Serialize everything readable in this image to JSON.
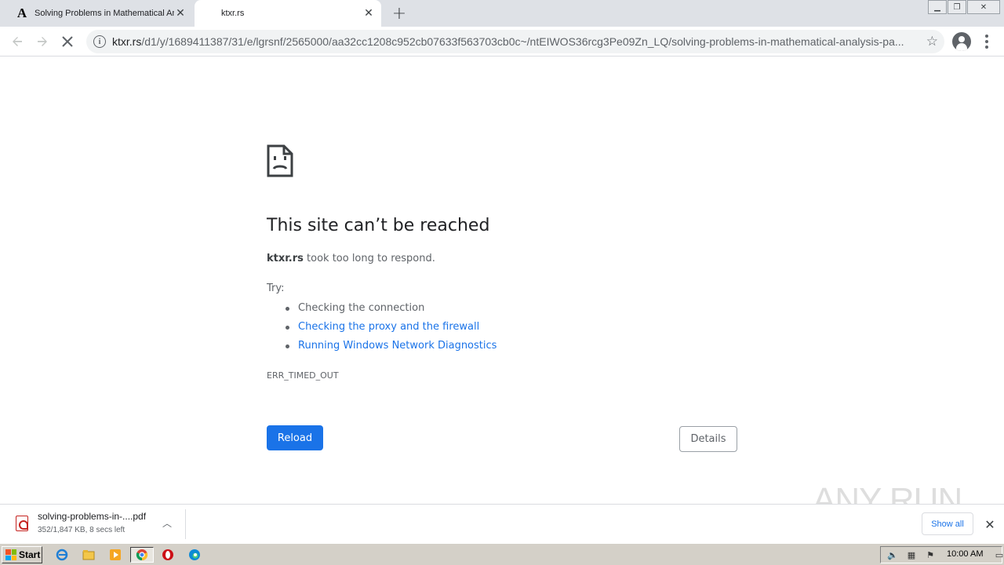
{
  "tabs": [
    {
      "title": "Solving Problems in Mathematical An",
      "favicon": "A",
      "active": false
    },
    {
      "title": "ktxr.rs",
      "active": true
    }
  ],
  "address_bar": {
    "host": "ktxr.rs",
    "path": "/d1/y/1689411387/31/e/lgrsnf/2565000/aa32cc1208c952cb07633f563703cb0c~/ntEIWOS36rcg3Pe09Zn_LQ/solving-problems-in-mathematical-analysis-pa..."
  },
  "error_page": {
    "title": "This site can’t be reached",
    "host": "ktxr.rs",
    "description": " took too long to respond.",
    "try_label": "Try:",
    "suggestions": [
      {
        "text": "Checking the connection",
        "link": false
      },
      {
        "text": "Checking the proxy and the firewall",
        "link": true
      },
      {
        "text": "Running Windows Network Diagnostics",
        "link": true
      }
    ],
    "error_code": "ERR_TIMED_OUT",
    "reload_label": "Reload",
    "details_label": "Details"
  },
  "watermark": "ANY RUN",
  "download_shelf": {
    "filename": "solving-problems-in-....pdf",
    "status": "352/1,847 KB, 8 secs left",
    "show_all_label": "Show all"
  },
  "taskbar": {
    "start_label": "Start",
    "clock": "10:00 AM"
  },
  "colors": {
    "accent": "#1a73e8",
    "tabstrip": "#dee1e6",
    "taskbar": "#d4d0c8"
  }
}
